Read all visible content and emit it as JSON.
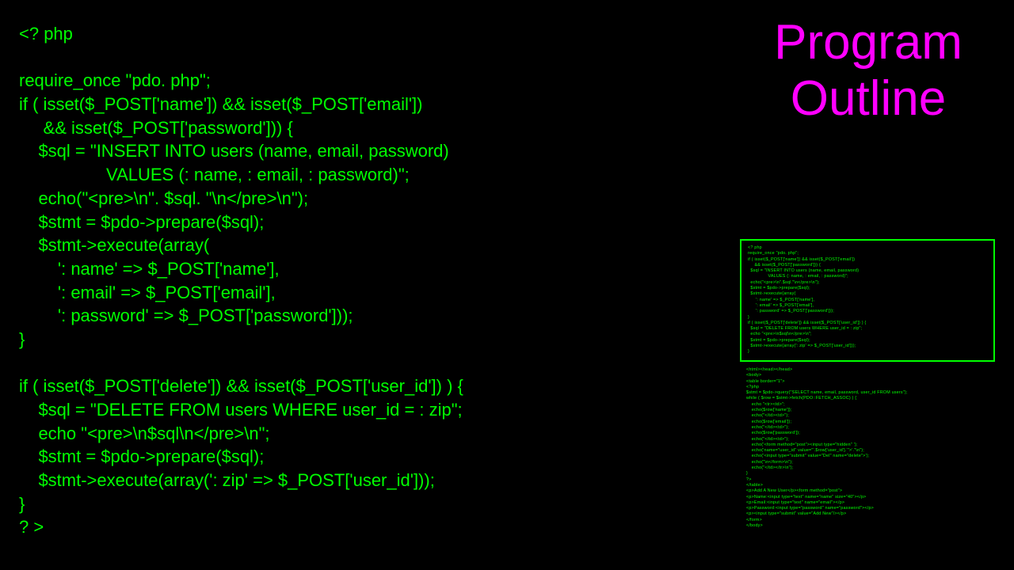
{
  "title": "Program\nOutline",
  "main_code": "<? php\n\nrequire_once \"pdo. php\";\nif ( isset($_POST['name']) && isset($_POST['email'])\n     && isset($_POST['password'])) {\n    $sql = \"INSERT INTO users (name, email, password)\n                  VALUES (: name, : email, : password)\";\n    echo(\"<pre>\\n\". $sql. \"\\n</pre>\\n\");\n    $stmt = $pdo->prepare($sql);\n    $stmt->execute(array(\n        ': name' => $_POST['name'],\n        ': email' => $_POST['email'],\n        ': password' => $_POST['password']));\n}\n\nif ( isset($_POST['delete']) && isset($_POST['user_id']) ) {\n    $sql = \"DELETE FROM users WHERE user_id = : zip\";\n    echo \"<pre>\\n$sql\\n</pre>\\n\";\n    $stmt = $pdo->prepare($sql);\n    $stmt->execute(array(': zip' => $_POST['user_id']));\n}\n? >",
  "mini_box": "<? php\nrequire_once \"pdo. php\";\nif ( isset($_POST['name']) && isset($_POST['email'])\n     && isset($_POST['password'])) {\n  $sql = \"INSERT INTO users (name, email, password)\n               VALUES (: name, : email, : password)\";\n  echo(\"<pre>\\n\".$sql.\"\\n</pre>\\n\");\n  $stmt = $pdo->prepare($sql);\n  $stmt->execute(array(\n      ': name' => $_POST['name'],\n      ': email' => $_POST['email'],\n      ': password' => $_POST['password']));\n}\nif ( isset($_POST['delete']) && isset($_POST['user_id']) ) {\n  $sql = \"DELETE FROM users WHERE user_id = : zip\";\n  echo \"<pre>\\n$sql\\n</pre>\\n\";\n  $stmt = $pdo->prepare($sql);\n  $stmt->execute(array(': zip' => $_POST['user_id']));\n}",
  "mini_below": "<html><head></head>\n<body>\n<table border=\"1\">\n<?php\n$stmt = $pdo->query(\"SELECT name, email, password, user_id FROM users\");\nwhile ( $row = $stmt->fetch(PDO::FETCH_ASSOC) ) {\n    echo \"<tr><td>\";\n    echo($row['name']);\n    echo(\"</td><td>\");\n    echo($row['email']);\n    echo(\"</td><td>\");\n    echo($row['password']);\n    echo(\"</td><td>\");\n    echo('<form method=\"post\"><input type=\"hidden\" ');\n    echo('name=\"user_id\" value=\"'.$row['user_id'].'\">'.\"\\n\");\n    echo('<input type=\"submit\" value=\"Del\" name=\"delete\">');\n    echo(\"\\n</form>\\n\");\n    echo(\"</td></tr>\\n\");\n}\n?>\n</table>\n<p>Add A New User</p><form method=\"post\">\n<p>Name:<input type=\"text\" name=\"name\" size=\"40\"></p>\n<p>Email:<input type=\"text\" name=\"email\"></p>\n<p>Password:<input type=\"password\" name=\"password\"></p>\n<p><input type=\"submit\" value=\"Add New\"/></p>\n</form>\n</body>"
}
